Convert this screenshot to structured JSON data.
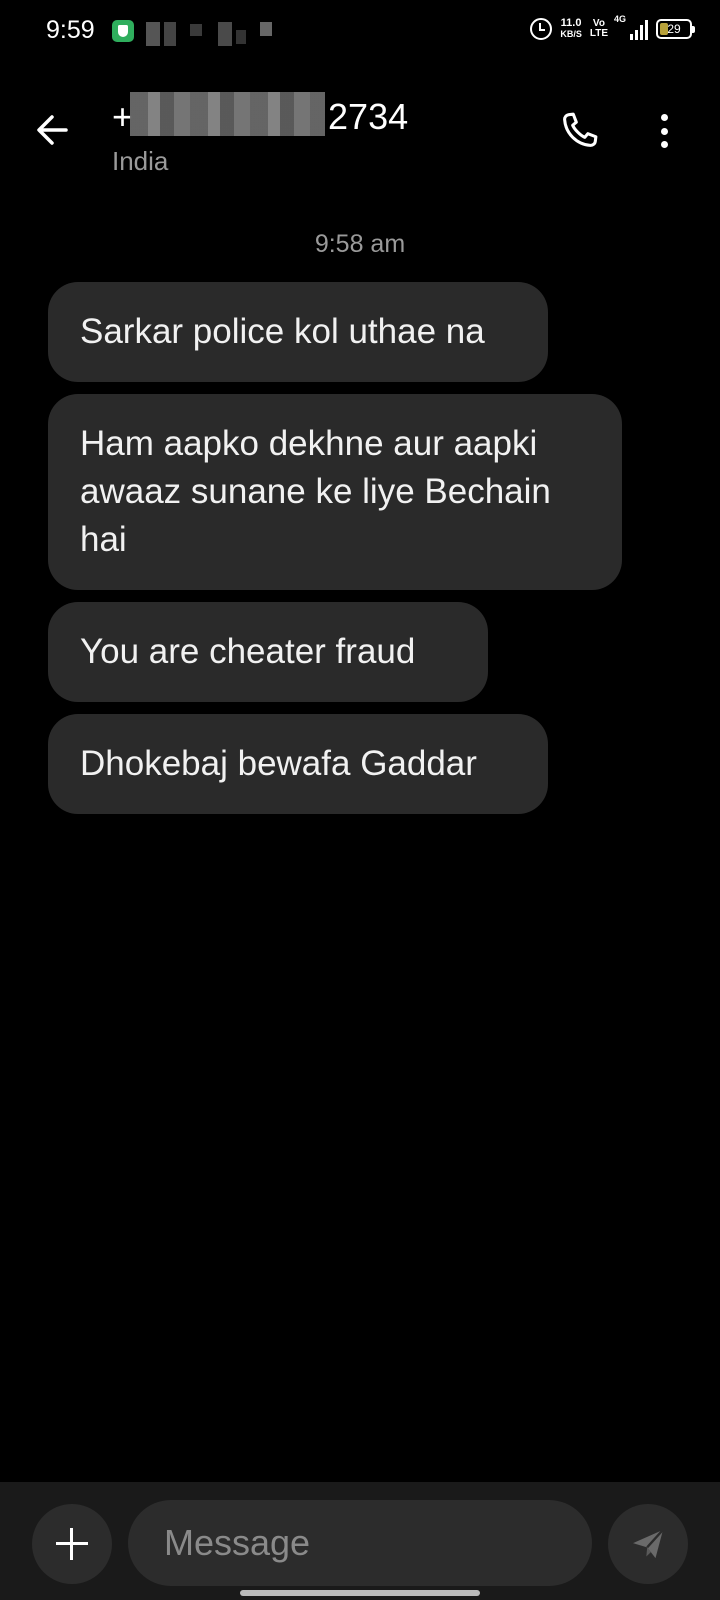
{
  "status_bar": {
    "time": "9:59",
    "net_speed_value": "11.0",
    "net_speed_unit": "KB/S",
    "volte_top": "Vo",
    "volte_bottom": "LTE",
    "network": "4G",
    "battery": "29",
    "icons": [
      "shield-app-icon",
      "alarm-icon",
      "signal-icon",
      "battery-icon"
    ]
  },
  "header": {
    "contact_prefix": "+",
    "contact_suffix": "2734",
    "contact_subtitle": "India",
    "icons": [
      "back-arrow-icon",
      "phone-icon",
      "more-vert-icon"
    ]
  },
  "thread": {
    "timestamp": "9:58 am",
    "messages": [
      {
        "text": "Sarkar police kol uthae na"
      },
      {
        "text": "Ham aapko dekhne aur aapki awaaz sunane ke liye Bechain hai"
      },
      {
        "text": "You are cheater fraud"
      },
      {
        "text": "Dhokebaj bewafa Gaddar"
      }
    ]
  },
  "composer": {
    "placeholder": "Message",
    "icons": [
      "plus-icon",
      "send-icon"
    ]
  },
  "colors": {
    "background": "#000000",
    "bubble": "#2a2a2a",
    "secondary_text": "#9a9a9a",
    "composer_bg": "#1a1a1a"
  }
}
